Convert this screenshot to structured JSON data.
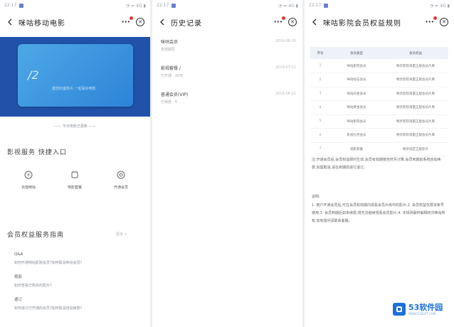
{
  "panel1": {
    "status": {
      "time": "22:17",
      "right": "◔ ᯤ 4G ▮"
    },
    "title": "咪咕移动电影",
    "card": {
      "number": "/2",
      "slogan": "邀您的金影片,一起看好电影"
    },
    "caption": "—— 今日电影已更新 ——",
    "quick": {
      "title": "影视服务 快捷入口",
      "items": [
        {
          "label": "充值咪咕"
        },
        {
          "label": "电影套餐"
        },
        {
          "label": "开通会员"
        }
      ]
    },
    "guide": {
      "title": "会员权益服务指南",
      "more": "更多 >",
      "items": [
        {
          "q": "Q&A",
          "a": "如何开通咪咕影院会员?如何取消咪咕会员?"
        },
        {
          "q": "观影",
          "a": "如何查看已购买的影片?"
        },
        {
          "q": "退订",
          "a": "如何退订已开通的会员?如何取消自动续费?"
        }
      ]
    }
  },
  "panel2": {
    "status": {
      "time": "22:17",
      "right": "◔ ᯤ 4G ▮"
    },
    "title": "历史记录",
    "records": [
      {
        "name": "咪咕会员",
        "meta": "有效期至",
        "time": "2019-08-20"
      },
      {
        "name": "影视套餐 / ",
        "meta": "已开通 · 30天",
        "time": "2019-07-21"
      },
      {
        "name": "普通会员(VIP)",
        "meta": "已续费 · ¥",
        "time": "2019-06-21"
      }
    ]
  },
  "panel3": {
    "status": {
      "time": "22:17",
      "right": "◔ ᯤ 4G ▮"
    },
    "title": "咪咕影院会员权益规则",
    "table": {
      "headers": [
        "序号",
        "会员类型",
        "会员权益"
      ],
      "rows": [
        [
          "1",
          "咪咕影院会员",
          "畅享影院海量正版会员片库"
        ],
        [
          "2",
          "咪咕钻石会员",
          "畅享影院海量正版会员片库"
        ],
        [
          "3",
          "咪咕白金会员",
          "畅享影院海量正版会员片库"
        ],
        [
          "4",
          "咪咕黄金会员",
          "畅享影院海量正版会员片库"
        ],
        [
          "5",
          "咪咕影院会员",
          "畅享影院海量正版会员片库"
        ],
        [
          "6",
          "影视包月会员",
          "畅享影院海量正版会员片库"
        ],
        [
          "7",
          "观影套餐",
          "畅享指定正版影片"
        ]
      ]
    },
    "para1": "注:开通会员后,会员权益即时生效,会员有效期按自然月计算,会员到期前系统自动续费,如需取消,请在到期前进行退订。",
    "para2_title": "说明:",
    "para2": "1. 用户开通会员后,可在会员有效期内观看会员片库中的影片;2. 会员权益仅限本账号使用;3. 会员到期后如未续费,将无法继续观看会员影片;4. 本规则最终解释权归咪咕所有,如有疑问请联系客服。"
  },
  "watermark": {
    "brand": "53软件园",
    "url": "WWW.53SOFT.COM"
  }
}
